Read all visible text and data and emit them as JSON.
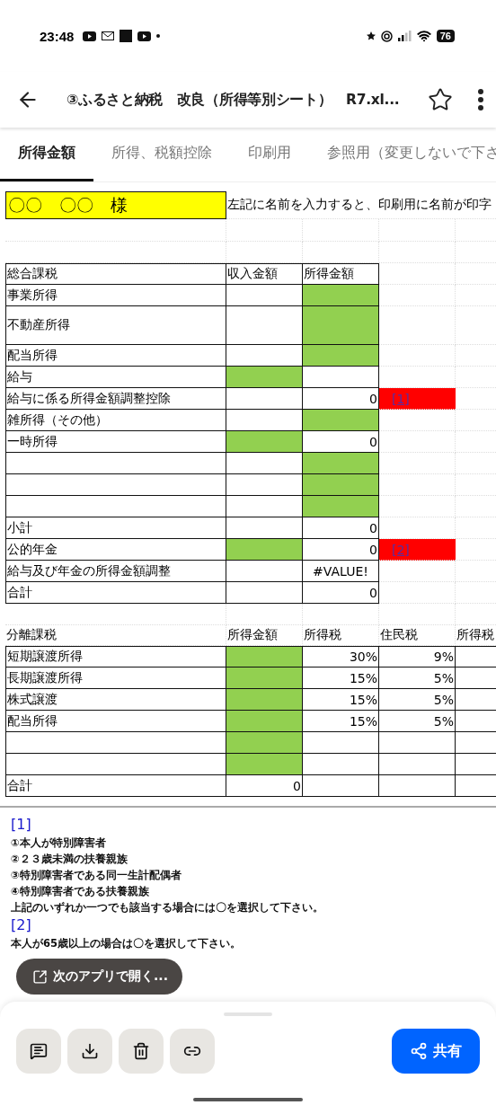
{
  "status_bar": {
    "time": "23:48",
    "battery": "76"
  },
  "header": {
    "title": "③ふるさと納税　改良（所得等別シート）　R7.xl..."
  },
  "tabs": [
    {
      "label": "所得金額",
      "selected": true
    },
    {
      "label": "所得、税額控除",
      "selected": false
    },
    {
      "label": "印刷用",
      "selected": false
    },
    {
      "label": "参照用（変更しないで下さ",
      "selected": false
    }
  ],
  "name_row": {
    "name": "〇〇　〇〇　様",
    "note": "左記に名前を入力すると、印刷用に名前が印字"
  },
  "general_table": {
    "columns": [
      "総合課税",
      "収入金額",
      "所得金額"
    ],
    "rows": [
      {
        "kind": "normal",
        "cells": [
          {
            "value": "事業所得",
            "highlighted": false
          },
          {
            "highlighted": false
          },
          {
            "highlighted": true
          }
        ]
      },
      {
        "kind": "tall",
        "cells": [
          {
            "value": "不動産所得",
            "highlighted": false
          },
          {
            "highlighted": false
          },
          {
            "highlighted": true
          }
        ]
      },
      {
        "kind": "normal",
        "cells": [
          {
            "value": "配当所得",
            "highlighted": false
          },
          {
            "highlighted": false
          },
          {
            "highlighted": true
          }
        ]
      },
      {
        "kind": "normal",
        "cells": [
          {
            "value": "給与",
            "highlighted": false
          },
          {
            "highlighted": true
          },
          {
            "highlighted": false
          }
        ]
      },
      {
        "kind": "normal",
        "cells": [
          {
            "value": "給与に係る所得金額調整控除",
            "highlighted": false
          },
          {
            "highlighted": false
          },
          {
            "highlighted": false,
            "value": "0"
          }
        ],
        "flag": "[1]"
      },
      {
        "kind": "normal",
        "cells": [
          {
            "value": "雑所得（その他）",
            "highlighted": false
          },
          {
            "highlighted": false
          },
          {
            "highlighted": true
          }
        ]
      },
      {
        "kind": "normal",
        "cells": [
          {
            "value": "一時所得",
            "highlighted": false
          },
          {
            "highlighted": true
          },
          {
            "highlighted": false,
            "value": "0"
          }
        ]
      },
      {
        "kind": "normal",
        "cells": [
          {
            "highlighted": false
          },
          {
            "highlighted": false
          },
          {
            "highlighted": true
          }
        ]
      },
      {
        "kind": "normal",
        "cells": [
          {
            "highlighted": false
          },
          {
            "highlighted": false
          },
          {
            "highlighted": true
          }
        ]
      },
      {
        "kind": "normal",
        "cells": [
          {
            "highlighted": false
          },
          {
            "highlighted": false
          },
          {
            "highlighted": true
          }
        ]
      },
      {
        "kind": "normal",
        "cells": [
          {
            "value": "小計",
            "highlighted": false
          },
          {
            "highlighted": false
          },
          {
            "highlighted": false,
            "value": "0"
          }
        ]
      },
      {
        "kind": "normal",
        "cells": [
          {
            "value": "公的年金",
            "highlighted": false
          },
          {
            "highlighted": true
          },
          {
            "highlighted": false,
            "value": "0"
          }
        ],
        "flag": "[2]"
      },
      {
        "kind": "normal",
        "cells": [
          {
            "value": "給与及び年金の所得金額調整",
            "highlighted": false
          },
          {
            "highlighted": false
          },
          {
            "highlighted": false,
            "value": "#VALUE!",
            "centered": true
          }
        ]
      },
      {
        "kind": "normal",
        "cells": [
          {
            "value": "合計",
            "highlighted": false
          },
          {
            "highlighted": false
          },
          {
            "highlighted": false,
            "value": "0"
          }
        ]
      }
    ]
  },
  "separate_table": {
    "columns": [
      "分離課税",
      "所得金額",
      "所得税",
      "住民税",
      "所得税"
    ],
    "rows": [
      {
        "cells": [
          {
            "value": "短期譲渡所得",
            "highlighted": false
          },
          {
            "highlighted": true
          },
          {
            "highlighted": false,
            "value": "30%"
          },
          {
            "highlighted": false,
            "value": "9%"
          },
          {
            "highlighted": false
          }
        ]
      },
      {
        "cells": [
          {
            "value": "長期譲渡所得",
            "highlighted": false
          },
          {
            "highlighted": true
          },
          {
            "highlighted": false,
            "value": "15%"
          },
          {
            "highlighted": false,
            "value": "5%"
          },
          {
            "highlighted": false
          }
        ]
      },
      {
        "cells": [
          {
            "value": "株式譲渡",
            "highlighted": false
          },
          {
            "highlighted": true
          },
          {
            "highlighted": false,
            "value": "15%"
          },
          {
            "highlighted": false,
            "value": "5%"
          },
          {
            "highlighted": false
          }
        ]
      },
      {
        "cells": [
          {
            "value": "配当所得",
            "highlighted": false
          },
          {
            "highlighted": true
          },
          {
            "highlighted": false,
            "value": "15%"
          },
          {
            "highlighted": false,
            "value": "5%"
          },
          {
            "highlighted": false
          }
        ]
      },
      {
        "cells": [
          {
            "highlighted": false
          },
          {
            "highlighted": true
          },
          {
            "highlighted": false
          },
          {
            "highlighted": false
          },
          {
            "highlighted": false
          }
        ]
      },
      {
        "cells": [
          {
            "highlighted": false
          },
          {
            "highlighted": true
          },
          {
            "highlighted": false
          },
          {
            "highlighted": false
          },
          {
            "highlighted": false
          }
        ]
      },
      {
        "cells": [
          {
            "value": "合計",
            "highlighted": false
          },
          {
            "highlighted": false,
            "value": "0"
          },
          {
            "highlighted": false
          },
          {
            "highlighted": false
          },
          {
            "highlighted": false
          }
        ]
      }
    ]
  },
  "footnotes": [
    {
      "link": "[1]",
      "lines": [
        "①本人が特別障害者",
        "②２３歳未満の扶養親族",
        "③特別障害者である同一生計配偶者",
        "④特別障害者である扶養親族",
        "上記のいずれか一つでも該当する場合には〇を選択して下さい。"
      ]
    },
    {
      "link": "[2]",
      "lines": [
        "本人が65歳以上の場合は〇を選択して下さい。"
      ]
    }
  ],
  "open_with": {
    "label": "次のアプリで開く..."
  },
  "actions": {
    "share": "共有"
  }
}
